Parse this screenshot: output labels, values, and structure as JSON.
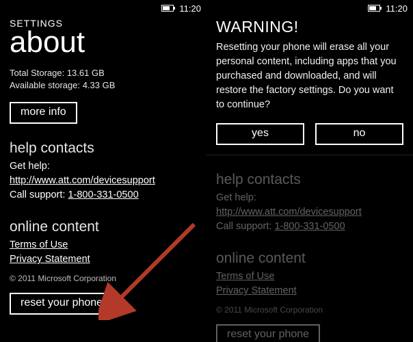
{
  "status": {
    "time": "11:20"
  },
  "left": {
    "header_small": "SETTINGS",
    "header_large": "about",
    "storage_total": "Total Storage: 13.61 GB",
    "storage_avail": "Available storage: 4.33 GB",
    "more_info": "more info",
    "help_heading": "help contacts",
    "help_prefix": "Get help: ",
    "help_url": "http://www.att.com/devicesupport",
    "call_prefix": "Call support: ",
    "call_number": "1-800-331-0500",
    "online_heading": "online content",
    "terms": "Terms of Use",
    "privacy": "Privacy Statement",
    "copyright": "© 2011 Microsoft Corporation",
    "reset": "reset your phone"
  },
  "right": {
    "warning_title": "WARNING!",
    "warning_body": "Resetting your phone will erase all your personal content, including apps that you purchased and downloaded, and will restore the factory settings. Do you want to continue?",
    "yes": "yes",
    "no": "no"
  }
}
